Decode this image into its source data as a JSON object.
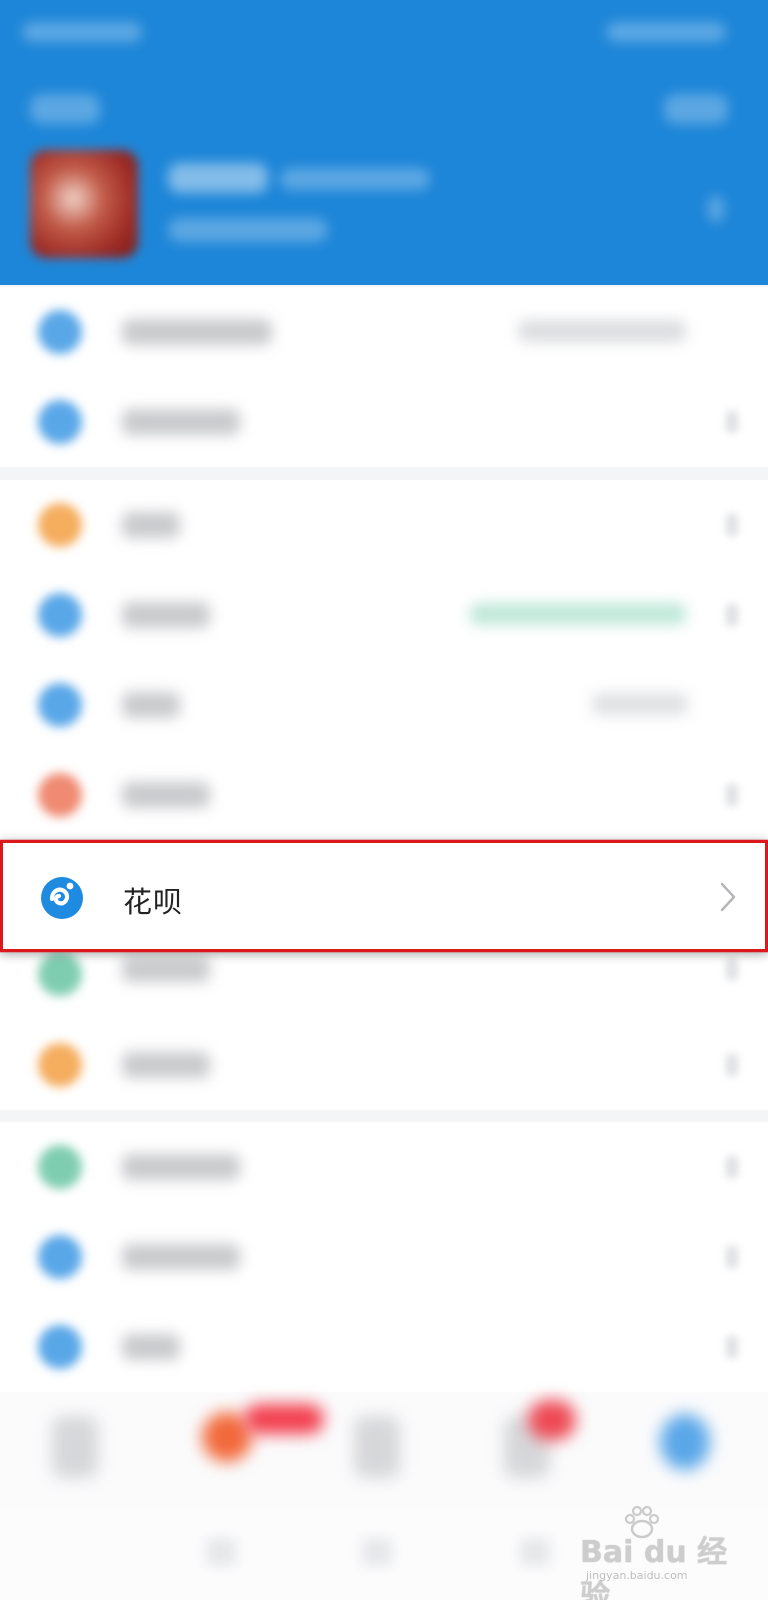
{
  "list": {
    "highlighted_item": {
      "label": "花呗",
      "icon": "huabei-icon"
    }
  },
  "watermark": {
    "brand": "Bai du 经验",
    "url": "jingyan.baidu.com"
  },
  "colors": {
    "header_blue": "#1e86d8",
    "highlight_border": "#d9191b",
    "huabei_blue": "#1e8be0"
  }
}
